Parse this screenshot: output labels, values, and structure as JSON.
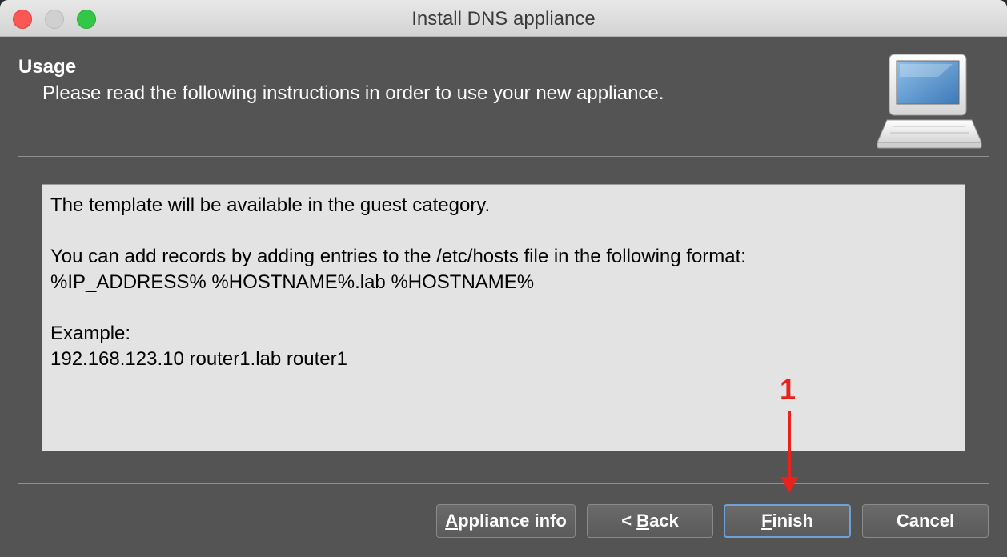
{
  "window": {
    "title": "Install DNS appliance"
  },
  "header": {
    "heading": "Usage",
    "subheading": "Please read the following instructions in order to use your new appliance."
  },
  "instructions": {
    "line1": "The template will be available in the guest category.",
    "line2": "You can add records by adding entries to the /etc/hosts file in the following format:",
    "line3": "%IP_ADDRESS% %HOSTNAME%.lab %HOSTNAME%",
    "line4": "Example:",
    "line5": "192.168.123.10 router1.lab router1"
  },
  "buttons": {
    "appliance_info": {
      "mnemonic": "A",
      "rest": "ppliance info"
    },
    "back": {
      "prefix": "< ",
      "mnemonic": "B",
      "rest": "ack"
    },
    "finish": {
      "mnemonic": "F",
      "rest": "inish"
    },
    "cancel": {
      "label": "Cancel"
    }
  },
  "annotation": {
    "step_label": "1",
    "color": "#e8231e"
  },
  "icons": {
    "appliance": "computer-monitor-icon"
  }
}
